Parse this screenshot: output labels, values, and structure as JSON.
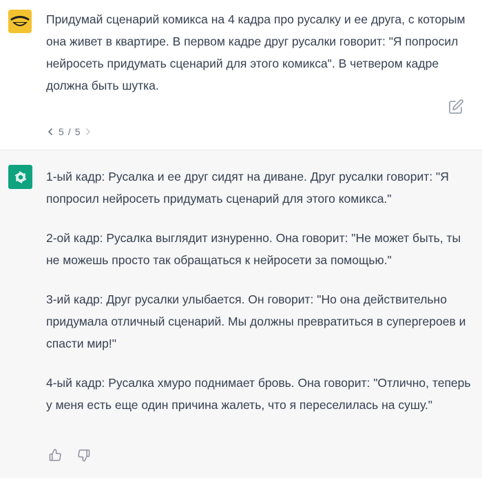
{
  "user_message": {
    "text": "Придумай сценарий комикса на 4 кадра про русалку и ее друга, с которым она живет в квартире. В первом кадре друг русалки говорит: \"Я попросил нейросеть придумать сценарий для этого комикса\". В четвером кадре должна быть шутка.",
    "pager": {
      "current": "5",
      "separator": "/",
      "total": "5"
    },
    "avatar_icon": "smiling-face-icon",
    "edit_icon": "edit-icon"
  },
  "assistant_message": {
    "paragraphs": [
      "1-ый кадр: Русалка и ее друг сидят на диване. Друг русалки говорит: \"Я попросил нейросеть придумать сценарий для этого комикса.\"",
      "2-ой кадр: Русалка выглядит изнуренно. Она говорит: \"Не может быть, ты не можешь просто так обращаться к нейросети за помощью.\"",
      "3-ий кадр: Друг русалки улыбается. Он говорит: \"Но она действительно придумала отличный сценарий. Мы должны превратиться в супергероев и спасти мир!\"",
      "4-ый кадр: Русалка хмуро поднимает бровь. Она говорит: \"Отлично, теперь у меня есть еще один причина жалеть, что я переселилась на сушу.\""
    ],
    "avatar_icon": "openai-logo-icon",
    "feedback_icons": [
      "thumbs-up-icon",
      "thumbs-down-icon"
    ]
  },
  "colors": {
    "user_avatar_bg": "#f3c22f",
    "assistant_avatar_bg": "#10a37f",
    "assistant_bg": "#f7f7f8",
    "text": "#374151",
    "muted": "#6b7280"
  }
}
